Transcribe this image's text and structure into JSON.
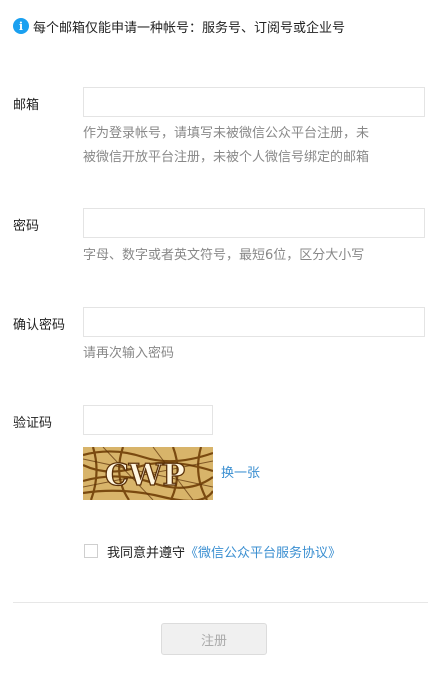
{
  "notice": {
    "icon": "info-icon",
    "text": "每个邮箱仅能申请一种帐号：服务号、订阅号或企业号"
  },
  "form": {
    "email": {
      "label": "邮箱",
      "value": "",
      "hint_line1": "作为登录帐号，请填写未被微信公众平台注册，未",
      "hint_line2": "被微信开放平台注册，未被个人微信号绑定的邮箱"
    },
    "password": {
      "label": "密码",
      "value": "",
      "hint": "字母、数字或者英文符号，最短6位，区分大小写"
    },
    "confirm_password": {
      "label": "确认密码",
      "value": "",
      "hint": "请再次输入密码"
    },
    "captcha": {
      "label": "验证码",
      "value": "",
      "image_text": "CWP",
      "refresh_label": "换一张"
    }
  },
  "agreement": {
    "checked": false,
    "text": "我同意并遵守",
    "link": "《微信公众平台服务协议》"
  },
  "submit_label": "注册",
  "colors": {
    "link": "#3b8fd1",
    "info": "#1aa0f0",
    "hint": "#888888"
  }
}
